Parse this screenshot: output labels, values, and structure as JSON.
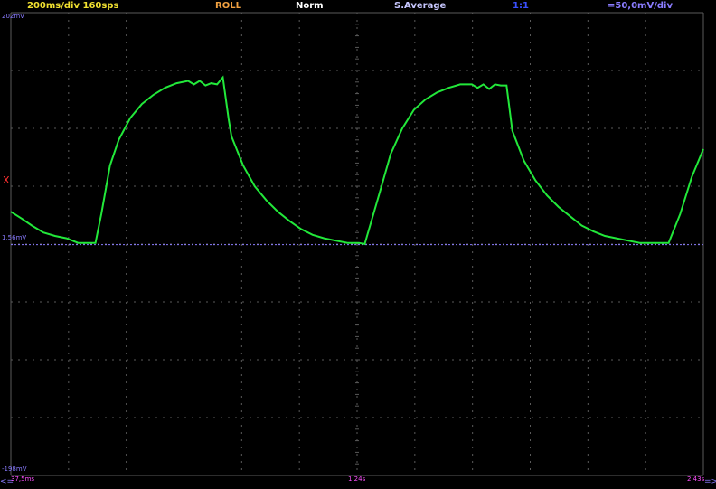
{
  "status_bar": {
    "timebase": "200ms/div  160sps",
    "mode": "ROLL",
    "trigger_mode": "Norm",
    "acquisition": "S.Average",
    "probe": "1:1",
    "volts_div": "=50,0mV/div"
  },
  "voltage_labels": {
    "top": "202mV",
    "bottom": "-198mV",
    "reference": "1,56mV",
    "trigger_marker": "X"
  },
  "time_labels": {
    "start": "37,5ms",
    "middle": "1,24s",
    "end": "2,43s",
    "left_arrow": "<=",
    "right_arrow": "=>"
  },
  "colors": {
    "trace": "#22e83a",
    "grid": "#5a5a5a",
    "reference_line": "#8a7cff",
    "background": "#000000"
  },
  "chart_data": {
    "type": "line",
    "ylim": [
      -198,
      202
    ],
    "xlim": [
      0.0375,
      2.43
    ],
    "y_unit": "mV",
    "x_unit": "s",
    "reference_level_mV": 1.56,
    "series": [
      {
        "x": [
          0.0375,
          0.075,
          0.11,
          0.15,
          0.19,
          0.23,
          0.27,
          0.31,
          0.33,
          0.35,
          0.38,
          0.41,
          0.45,
          0.49,
          0.53,
          0.57,
          0.61,
          0.65,
          0.67,
          0.69,
          0.71,
          0.73,
          0.75,
          0.77,
          0.79,
          0.8,
          0.84,
          0.88,
          0.92,
          0.96,
          1.0,
          1.04,
          1.08,
          1.12,
          1.16,
          1.2,
          1.24,
          1.26,
          1.31,
          1.35,
          1.39,
          1.43,
          1.47,
          1.51,
          1.55,
          1.59,
          1.63,
          1.65,
          1.67,
          1.69,
          1.71,
          1.73,
          1.75,
          1.77,
          1.81,
          1.85,
          1.89,
          1.93,
          1.97,
          2.01,
          2.05,
          2.09,
          2.13,
          2.17,
          2.21,
          2.25,
          2.28,
          2.31,
          2.35,
          2.39,
          2.43
        ],
        "y": [
          30,
          24,
          18,
          12,
          9,
          7,
          3,
          3,
          3,
          28,
          70,
          92,
          111,
          123,
          131,
          137,
          141,
          143,
          140,
          143,
          139,
          141,
          140,
          146,
          110,
          95,
          70,
          52,
          40,
          30,
          22,
          15,
          10,
          7,
          5,
          3,
          3,
          2,
          45,
          80,
          102,
          118,
          127,
          133,
          137,
          140,
          140,
          137,
          140,
          136,
          140,
          139,
          139,
          100,
          74,
          57,
          44,
          34,
          26,
          18,
          13,
          9,
          7,
          5,
          3,
          3,
          3,
          3,
          28,
          60,
          84
        ]
      }
    ]
  }
}
